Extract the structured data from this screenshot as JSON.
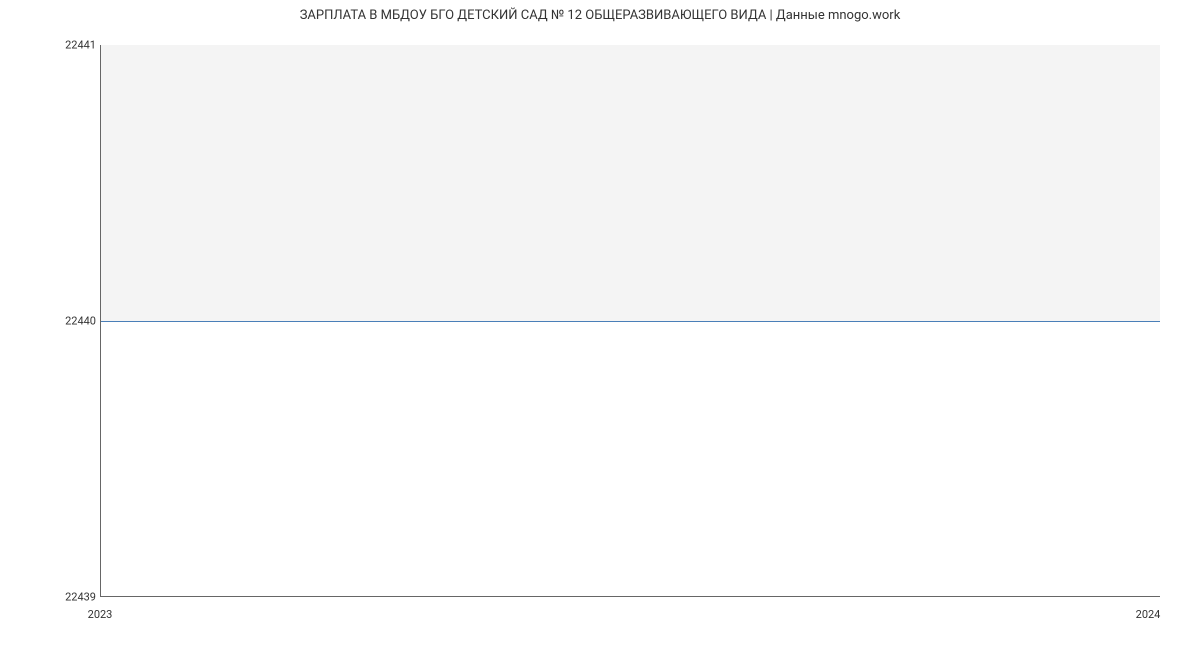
{
  "chart_data": {
    "type": "area",
    "title": "ЗАРПЛАТА В МБДОУ БГО ДЕТСКИЙ САД № 12 ОБЩЕРАЗВИВАЮЩЕГО ВИДА | Данные mnogo.work",
    "xlabel": "",
    "ylabel": "",
    "x": [
      2023,
      2024
    ],
    "values": [
      22440,
      22440
    ],
    "xlim": [
      2023,
      2024
    ],
    "ylim": [
      22439,
      22441
    ],
    "x_ticks": [
      "2023",
      "2024"
    ],
    "y_ticks": [
      "22441",
      "22440",
      "22439"
    ],
    "line_color": "#4a7fb8",
    "fill_color": "#f4f4f4"
  }
}
